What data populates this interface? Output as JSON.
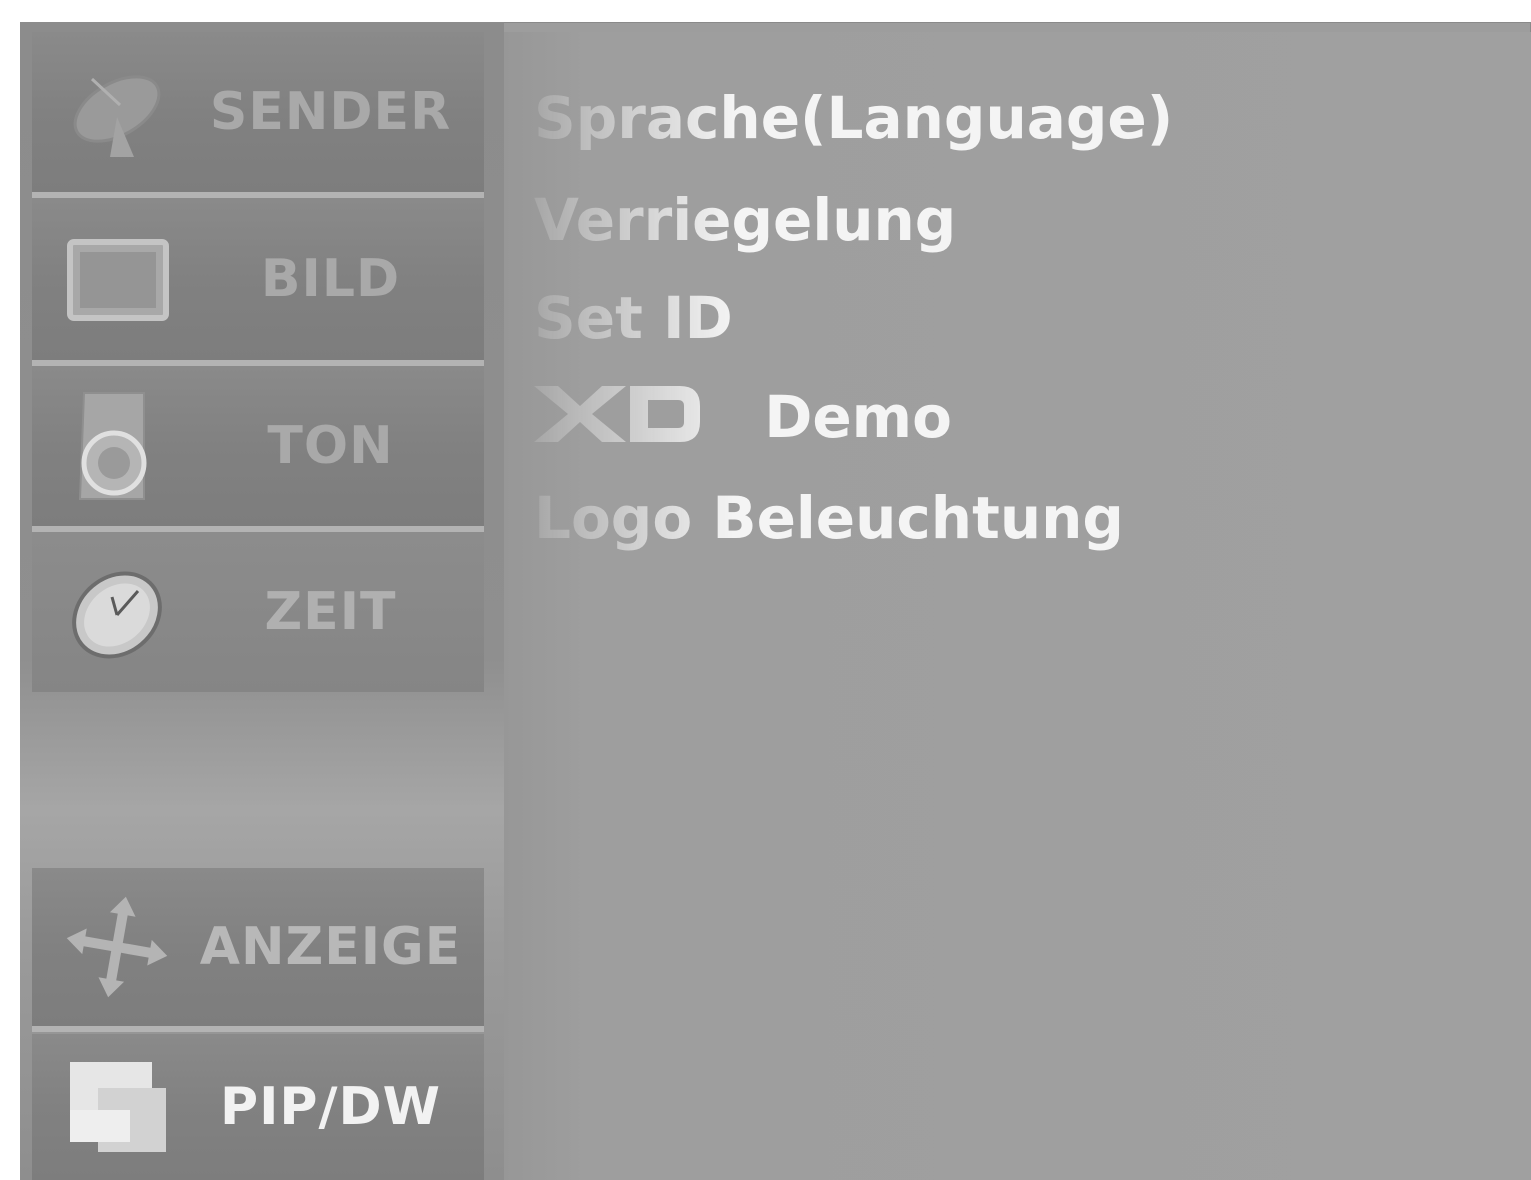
{
  "sidebar": {
    "items": [
      {
        "label": "SENDER",
        "icon": "satellite-dish-icon"
      },
      {
        "label": "BILD",
        "icon": "picture-screen-icon"
      },
      {
        "label": "TON",
        "icon": "speaker-icon"
      },
      {
        "label": "ZEIT",
        "icon": "clock-icon"
      },
      {
        "label": "ANZEIGE",
        "icon": "move-arrows-icon"
      },
      {
        "label": "PIP/DW",
        "icon": "pip-windows-icon"
      }
    ]
  },
  "menu": {
    "items": [
      {
        "label": "Sprache(Language)"
      },
      {
        "label": "Verriegelung"
      },
      {
        "label": "Set ID"
      },
      {
        "label": "Demo",
        "logo": "XD"
      },
      {
        "label": "Logo Beleuchtung"
      }
    ]
  },
  "colors": {
    "background": "#9d9d9d",
    "tile": "#828282",
    "text_active": "#f4f4f4",
    "text_dim": "#a9a9a9"
  }
}
